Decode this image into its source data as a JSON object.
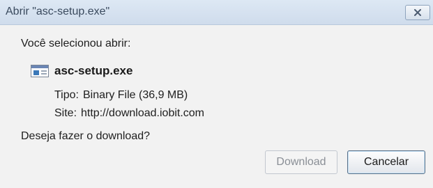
{
  "window": {
    "title": "Abrir \"asc-setup.exe\"",
    "close_icon": "close-icon"
  },
  "dialog": {
    "prompt": "Você selecionou abrir:",
    "file": {
      "icon": "executable-file-icon",
      "name": "asc-setup.exe",
      "type_label": "Tipo:",
      "type_value": "Binary File (36,9 MB)",
      "site_label": "Site:",
      "site_value": "http://download.iobit.com"
    },
    "question": "Deseja fazer o download?"
  },
  "buttons": {
    "download_label": "Download",
    "download_enabled": false,
    "cancel_label": "Cancelar"
  }
}
